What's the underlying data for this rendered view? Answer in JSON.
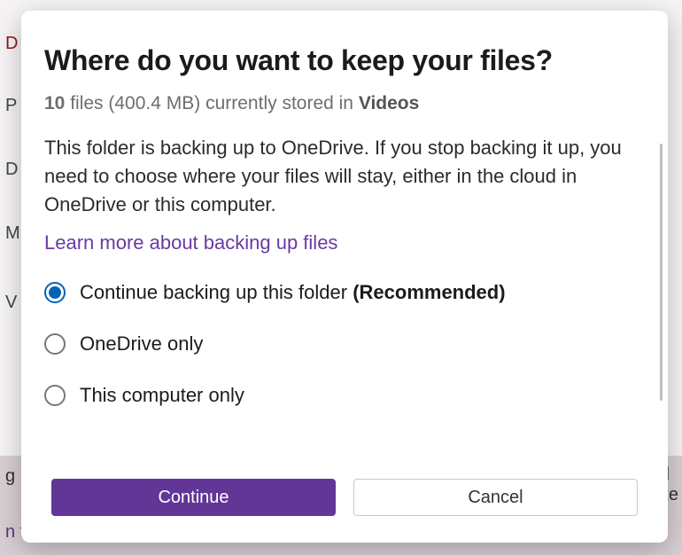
{
  "backdrop": {
    "rows": [
      "D",
      "P",
      "D",
      "M",
      "V"
    ],
    "footer_left_frag": "g",
    "footer_right_frag": "d\nke",
    "footer_link_frag": "n folder"
  },
  "dialog": {
    "title": "Where do you want to keep your files?",
    "storage": {
      "count": "10",
      "files_word": " files ",
      "size_word": "(400.4 MB) currently stored in ",
      "folder": "Videos"
    },
    "description": "This folder is backing up to OneDrive. If you stop backing it up, you need to choose where your files will stay, either in the cloud in OneDrive or this computer.",
    "learn_more": "Learn more about backing up files",
    "options": [
      {
        "label": "Continue backing up this folder ",
        "suffix": "(Recommended)",
        "selected": true
      },
      {
        "label": "OneDrive only",
        "suffix": "",
        "selected": false
      },
      {
        "label": "This computer only",
        "suffix": "",
        "selected": false
      }
    ],
    "buttons": {
      "continue": "Continue",
      "cancel": "Cancel"
    }
  }
}
